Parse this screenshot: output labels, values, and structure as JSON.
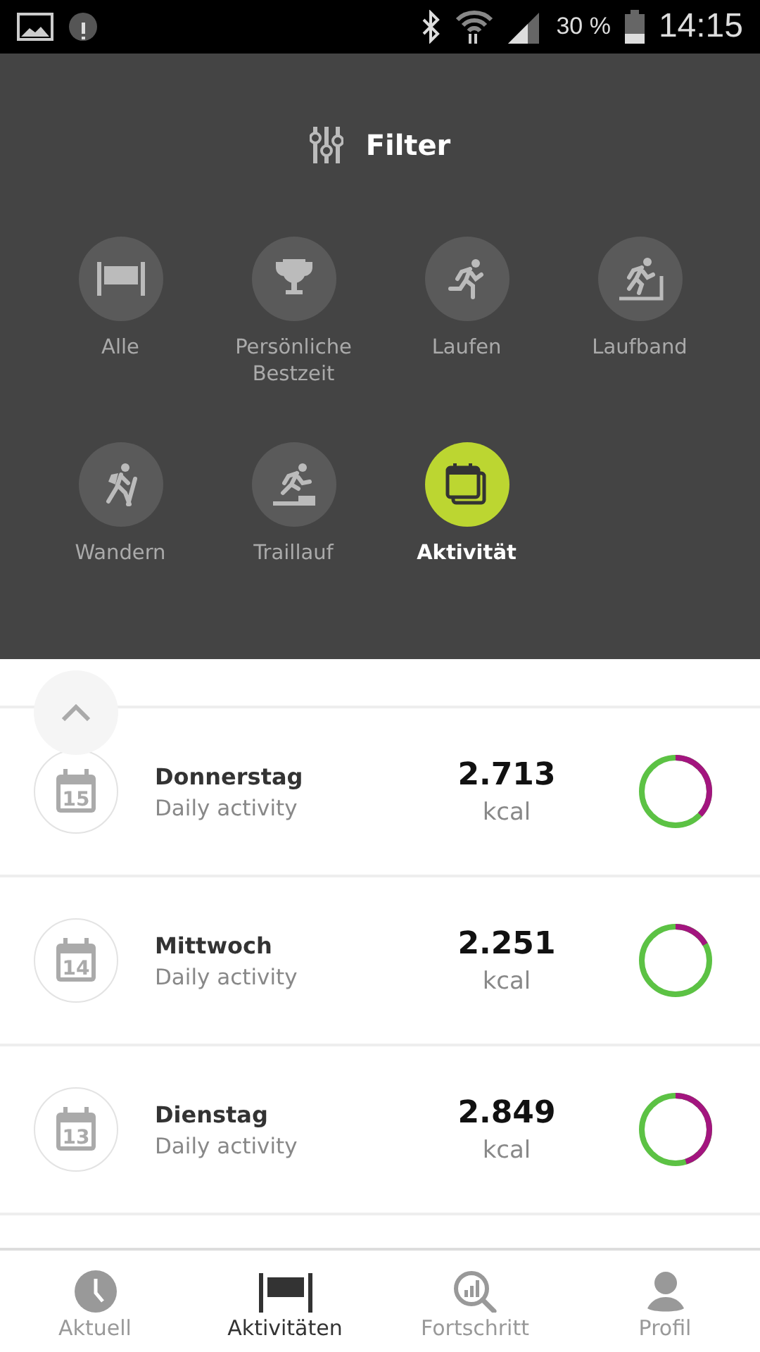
{
  "status_bar": {
    "battery": "30 %",
    "time": "14:15"
  },
  "filter": {
    "title": "Filter",
    "options": [
      {
        "kind": "all",
        "label": "Alle",
        "selected": false
      },
      {
        "kind": "trophy",
        "label": "Persönliche Bestzeit",
        "selected": false
      },
      {
        "kind": "run",
        "label": "Laufen",
        "selected": false
      },
      {
        "kind": "treadmill",
        "label": "Laufband",
        "selected": false
      },
      {
        "kind": "hike",
        "label": "Wandern",
        "selected": false
      },
      {
        "kind": "trail",
        "label": "Traillauf",
        "selected": false
      },
      {
        "kind": "calendar",
        "label": "Aktivität",
        "selected": true
      }
    ]
  },
  "activities": [
    {
      "date": "15",
      "day": "Donnerstag",
      "type": "Daily activity",
      "kcal": "2.713",
      "unit": "kcal",
      "level": 0.37
    },
    {
      "date": "14",
      "day": "Mittwoch",
      "type": "Daily activity",
      "kcal": "2.251",
      "unit": "kcal",
      "level": 0.17
    },
    {
      "date": "13",
      "day": "Dienstag",
      "type": "Daily activity",
      "kcal": "2.849",
      "unit": "kcal",
      "level": 0.45
    }
  ],
  "bottom_nav": [
    {
      "kind": "clock",
      "label": "Aktuell",
      "selected": false
    },
    {
      "kind": "flag",
      "label": "Aktivitäten",
      "selected": true
    },
    {
      "kind": "progress",
      "label": "Fortschritt",
      "selected": false
    },
    {
      "kind": "profile",
      "label": "Profil",
      "selected": false
    }
  ]
}
